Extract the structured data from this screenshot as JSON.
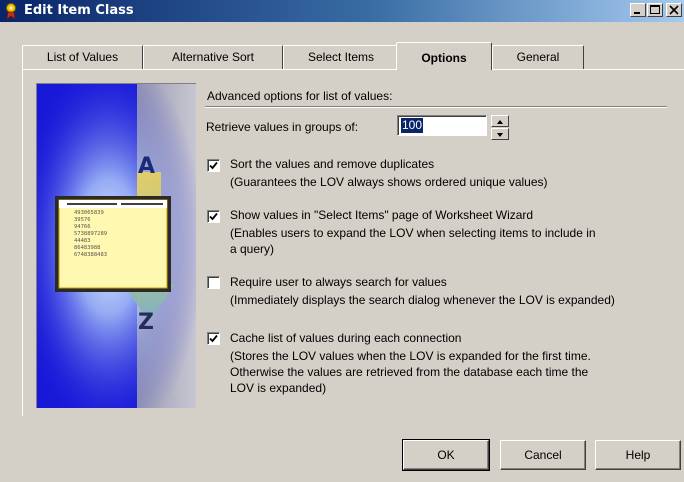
{
  "window": {
    "title": "Edit Item Class"
  },
  "tabs": [
    {
      "label": "List of Values"
    },
    {
      "label": "Alternative Sort"
    },
    {
      "label": "Select Items"
    },
    {
      "label": "Options",
      "active": true
    },
    {
      "label": "General"
    }
  ],
  "options": {
    "header": "Advanced options for list of values:",
    "retrieve_label": "Retrieve values in groups of:",
    "retrieve_value": "100",
    "items": [
      {
        "checked": true,
        "label": "Sort the values and remove duplicates",
        "desc": [
          "(Guarantees the LOV always shows ordered unique values)"
        ]
      },
      {
        "checked": true,
        "label": "Show values in \"Select Items\" page of Worksheet Wizard",
        "desc": [
          "(Enables users to expand the LOV when selecting items to include in",
          "a query)"
        ]
      },
      {
        "checked": false,
        "label": "Require user to always search for values",
        "desc": [
          "(Immediately displays the search dialog whenever the LOV is expanded)"
        ]
      },
      {
        "checked": true,
        "label": "Cache list of values during each connection",
        "desc": [
          "(Stores the LOV values when the LOV is expanded for the first time.",
          "Otherwise the values are retrieved from the database each time the",
          "LOV is expanded)"
        ]
      }
    ]
  },
  "illustration": {
    "letter_top": "A",
    "letter_bottom": "Z",
    "numbers": [
      "493065839",
      "39576",
      "94766",
      "5738897289",
      "44483",
      "86483988",
      "6748388483"
    ]
  },
  "buttons": {
    "ok": "OK",
    "cancel": "Cancel",
    "help": "Help"
  }
}
